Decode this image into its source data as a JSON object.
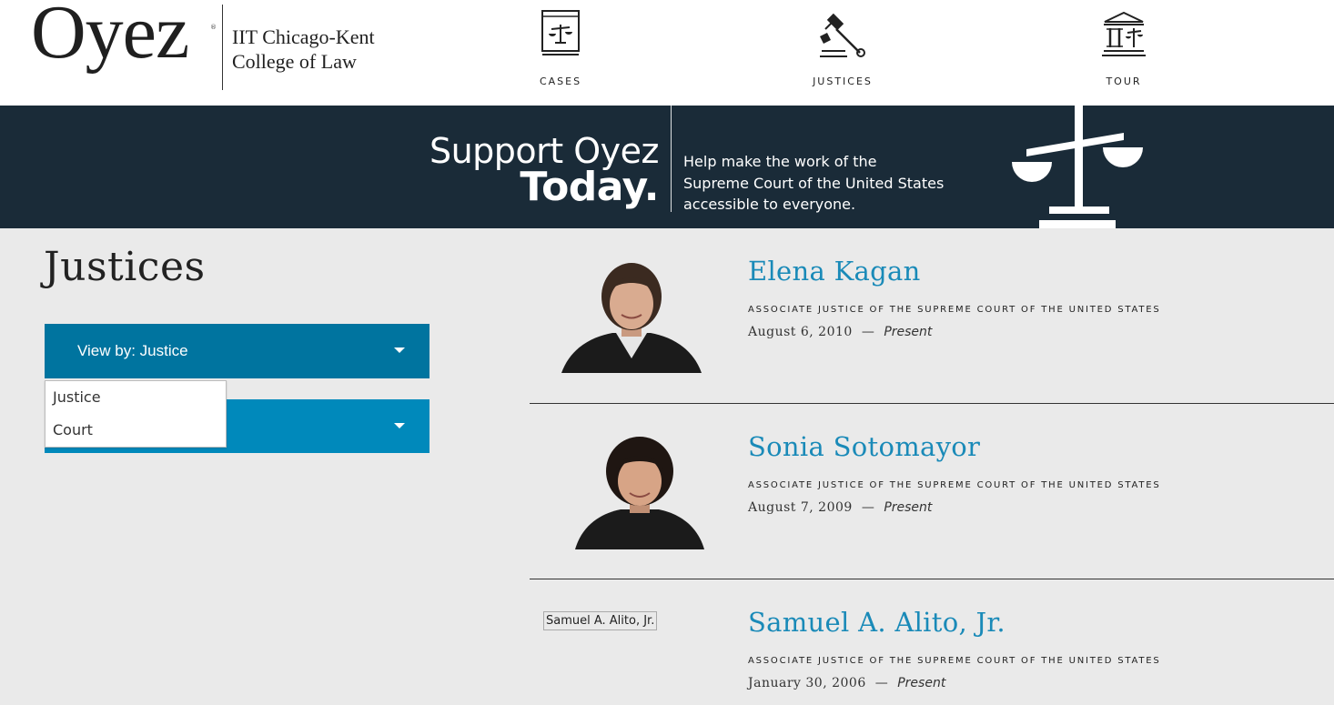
{
  "header": {
    "logo_text": "Oyez",
    "logo_registered": "®",
    "school_line1": "IIT Chicago-Kent",
    "school_line2": "College of Law",
    "nav": [
      {
        "label": "CASES",
        "icon": "book-scales-icon"
      },
      {
        "label": "JUSTICES",
        "icon": "gavel-icon"
      },
      {
        "label": "TOUR",
        "icon": "courthouse-icon"
      }
    ]
  },
  "banner": {
    "support": "Support Oyez",
    "today": "Today.",
    "tagline_line1": "Help make the work of the",
    "tagline_line2": "Supreme Court of the United States",
    "tagline_line3": "accessible to everyone.",
    "icon": "scales-of-justice-icon"
  },
  "page": {
    "title": "Justices",
    "view_by": {
      "label": "View by: Justice",
      "options": [
        "Justice",
        "Court"
      ]
    }
  },
  "justices": [
    {
      "name": "Elena Kagan",
      "role": "ASSOCIATE JUSTICE OF THE SUPREME COURT OF THE UNITED STATES",
      "start": "August 6, 2010",
      "end": "Present",
      "dash": "—"
    },
    {
      "name": "Sonia Sotomayor",
      "role": "ASSOCIATE JUSTICE OF THE SUPREME COURT OF THE UNITED STATES",
      "start": "August 7, 2009",
      "end": "Present",
      "dash": "—"
    },
    {
      "name": "Samuel A. Alito, Jr.",
      "role": "ASSOCIATE JUSTICE OF THE SUPREME COURT OF THE UNITED STATES",
      "start": "January 30, 2006",
      "end": "Present",
      "dash": "—",
      "image_alt": "Samuel A. Alito, Jr."
    }
  ],
  "colors": {
    "banner_bg": "#1a2b38",
    "select_primary": "#00749f",
    "select_secondary": "#0089bb",
    "link": "#1a8ab8",
    "page_bg": "#eaeaea"
  }
}
